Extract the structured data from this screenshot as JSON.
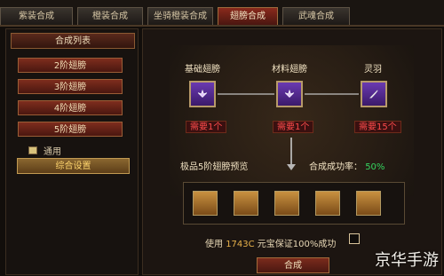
{
  "tabs": [
    {
      "label": "紫装合成"
    },
    {
      "label": "橙装合成"
    },
    {
      "label": "坐骑橙装合成"
    },
    {
      "label": "翅膀合成"
    },
    {
      "label": "武魂合成"
    }
  ],
  "left": {
    "header": "合成列表",
    "items": [
      {
        "label": "2阶翅膀"
      },
      {
        "label": "3阶翅膀"
      },
      {
        "label": "4阶翅膀"
      },
      {
        "label": "5阶翅膀"
      }
    ],
    "use_label": "通用",
    "yellow_btn": "综合设置"
  },
  "main": {
    "nodes": [
      {
        "label": "基础翅膀",
        "need": "需要1个",
        "icon": "wing-icon"
      },
      {
        "label": "材料翅膀",
        "need": "需要1个",
        "icon": "wing-icon"
      },
      {
        "label": "灵羽",
        "need": "需要15个",
        "icon": "feather-icon"
      }
    ],
    "preview_label": "极品5阶翅膀预览",
    "success_rate_label": "合成成功率：",
    "success_rate_value": "50%",
    "preview_slots": 5,
    "cost_prefix": "使用 ",
    "cost_value": "1743C",
    "cost_suffix": " 元宝保证100%成功",
    "action_button": "合成"
  },
  "watermark": "京华手游",
  "colors": {
    "red": "#ff4b4b",
    "green": "#35d45f",
    "gold": "#e7b14a"
  }
}
